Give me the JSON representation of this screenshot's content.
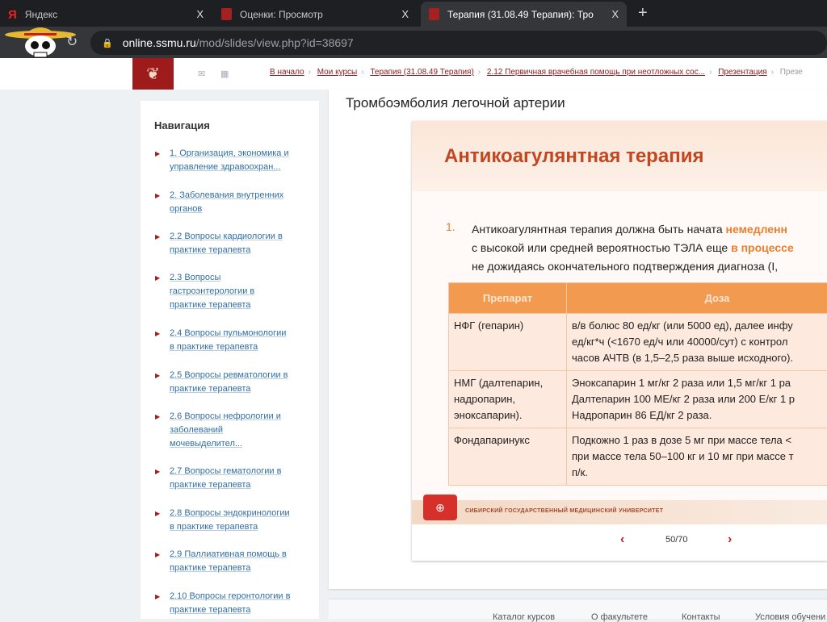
{
  "browser": {
    "tabs": [
      {
        "label": "Яндекс",
        "close": "X"
      },
      {
        "label": "Оценки: Просмотр",
        "close": "X"
      },
      {
        "label": "Терапия (31.08.49 Терапия): Тро",
        "close": "X"
      }
    ],
    "new_tab": "+",
    "url_host": "online.ssmu.ru",
    "url_path": "/mod/slides/view.php?id=38697"
  },
  "breadcrumb": [
    "В начало",
    "Мои курсы",
    "Терапия (31.08.49 Терапия)",
    "2.12 Первичная врачебная помощь при неотложных сос...",
    "Презентация",
    "Презе"
  ],
  "sidebar": {
    "title": "Навигация",
    "items": [
      [
        "1. Организация, экономика и",
        "управление здравоохран..."
      ],
      [
        "2. Заболевания внутренних",
        "органов"
      ],
      [
        "2.2 Вопросы кардиологии в",
        "практике терапевта"
      ],
      [
        "2.3 Вопросы",
        "гастроэнтерологии в",
        "практике терапевта"
      ],
      [
        "2.4 Вопросы пульмонологии",
        "в практике терапевта"
      ],
      [
        "2.5 Вопросы ревматологии в",
        "практике терапевта"
      ],
      [
        "2.6 Вопросы нефрологии и",
        "заболеваний",
        "мочевыделител..."
      ],
      [
        "2.7 Вопросы гематологии в",
        "практике терапевта"
      ],
      [
        "2.8 Вопросы эндокринологии",
        "в практике терапевта"
      ],
      [
        "2.9 Паллиативная помощь в",
        "практике терапевта"
      ],
      [
        "2.10 Вопросы геронтологии в",
        "практике терапевта"
      ]
    ]
  },
  "page_title": "Тромбоэмболия легочной артерии",
  "slide": {
    "title": "Антикоагулянтная терапия",
    "num": "1.",
    "p1a": "Антикоагулянтная терапия должна быть начата ",
    "p1b": "немедленн",
    "p2a": "с высокой или средней вероятностью ТЭЛА еще ",
    "p2b": "в процессе",
    "p3": "не дожидаясь окончательного подтверждения диагноза (I,",
    "headers": [
      "Препарат",
      "Доза"
    ],
    "rows": [
      {
        "drug": [
          "НФГ (гепарин)"
        ],
        "dose": [
          "в/в болюс 80 ед/кг (или 5000 ед), далее инфу",
          "ед/кг*ч (<1670 ед/ч или 40000/сут) с контрол",
          "часов АЧТВ (в 1,5–2,5 раза выше исходного)."
        ]
      },
      {
        "drug": [
          "НМГ (далтепарин,",
          "надропарин,",
          "эноксапарин)."
        ],
        "dose": [
          "Эноксапарин 1 мг/кг 2 раза или 1,5 мг/кг 1 ра",
          "Далтепарин 100 МЕ/кг 2 раза или 200 Е/кг 1 р",
          "Надропарин 86 ЕД/кг 2 раза."
        ]
      },
      {
        "drug": [
          "Фондапаринукс"
        ],
        "dose": [
          "Подкожно 1 раз в дозе 5 мг при массе тела <",
          "при массе тела 50–100 кг и 10 мг при массе т",
          "п/к."
        ]
      }
    ],
    "university": "СИБИРСКИЙ ГОСУДАРСТВЕННЫЙ МЕДИЦИНСКИЙ УНИВЕРСИТЕТ"
  },
  "pager": {
    "text": "50/70",
    "prev": "‹",
    "next": "›"
  },
  "footer": [
    "Каталог курсов",
    "О факультете",
    "Контакты",
    "Условия обучени"
  ]
}
